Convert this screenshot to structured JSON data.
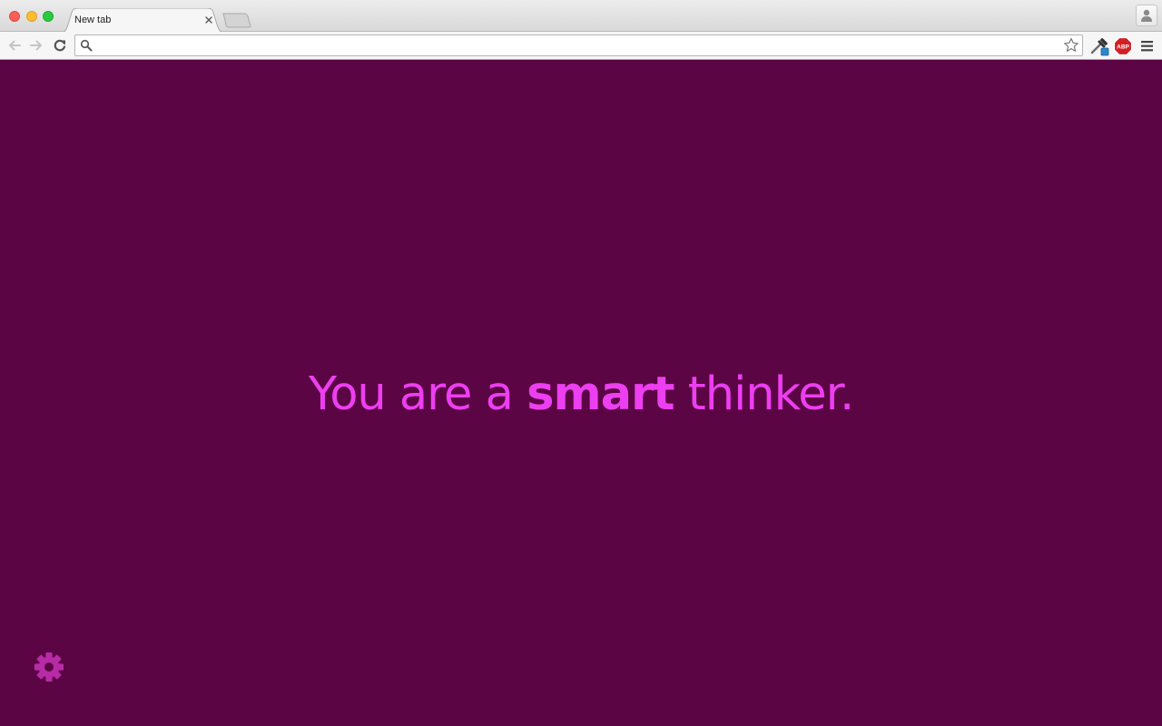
{
  "browser": {
    "tab": {
      "title": "New tab"
    },
    "address_bar": {
      "value": "",
      "placeholder": ""
    },
    "extensions": [
      {
        "name": "eyedropper-extension",
        "icon": "eyedropper-icon"
      },
      {
        "name": "adblock-plus",
        "icon": "abp-icon",
        "label": "ABP"
      }
    ]
  },
  "page": {
    "message": {
      "before": "You are a ",
      "emphasis": "smart",
      "after": " thinker."
    },
    "colors": {
      "background": "#5c0545",
      "text": "#ec3ff0",
      "gear": "#b82ba6"
    }
  }
}
